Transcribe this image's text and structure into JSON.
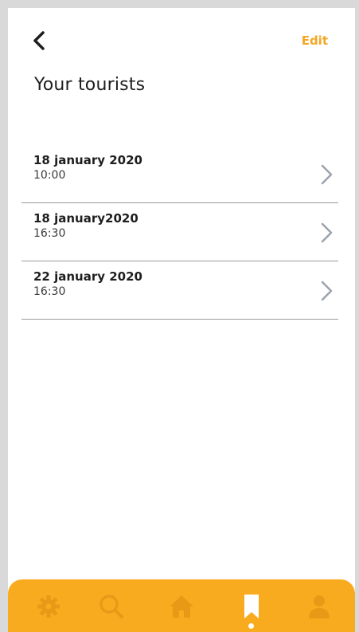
{
  "header": {
    "back_icon": "chevron-left-icon",
    "edit_label": "Edit",
    "title": "Your tourists"
  },
  "bookings": [
    {
      "date": "18 january 2020",
      "time": "10:00"
    },
    {
      "date": "18 january2020",
      "time": "16:30"
    },
    {
      "date": "22 january 2020",
      "time": "16:30"
    }
  ],
  "tabbar": {
    "items": [
      {
        "icon": "gear-icon",
        "active": false
      },
      {
        "icon": "search-icon",
        "active": false
      },
      {
        "icon": "home-icon",
        "active": false
      },
      {
        "icon": "bookmark-icon",
        "active": true
      },
      {
        "icon": "user-icon",
        "active": false
      }
    ]
  },
  "colors": {
    "accent": "#f5a623",
    "tabbar_bg": "#f9ab1f",
    "tab_icon_inactive": "#e89a17",
    "tab_icon_active": "#ffffff",
    "divider": "#9b9b9b",
    "chevron": "#9aa3ad"
  }
}
